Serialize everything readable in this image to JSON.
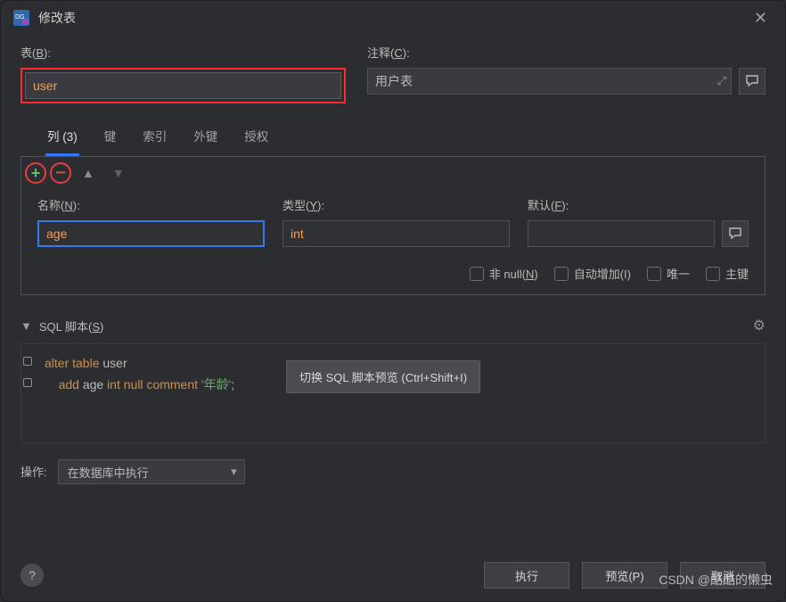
{
  "window": {
    "title": "修改表"
  },
  "labels": {
    "table": "表(",
    "table_u": "B",
    "table_end": "):",
    "comment": "注释(",
    "comment_u": "C",
    "comment_end": "):",
    "name": "名称(",
    "name_u": "N",
    "name_end": "):",
    "type": "类型(",
    "type_u": "Y",
    "type_end": "):",
    "default": "默认(",
    "default_u": "F",
    "default_end": "):",
    "sql": "SQL 脚本(",
    "sql_u": "S",
    "sql_end": ")",
    "ops": "操作:"
  },
  "fields": {
    "table_name": "user",
    "comment": "用户表",
    "col_name": "age",
    "col_type": "int",
    "col_default": ""
  },
  "tabs": [
    "列 (3)",
    "键",
    "索引",
    "外键",
    "授权"
  ],
  "checks": {
    "notnull": "非 null(",
    "notnull_u": "N",
    "notnull_end": ")",
    "autoinc": "自动增加(I)",
    "unique": "唯一",
    "pk": "主键"
  },
  "tooltip": "切换 SQL 脚本预览 (Ctrl+Shift+I)",
  "sql": {
    "l1_kw1": "alter",
    "l1_kw2": "table",
    "l1_id": "user",
    "l2_kw1": "add",
    "l2_id": "age",
    "l2_kw2": "int",
    "l2_kw3": "null",
    "l2_kw4": "comment",
    "l2_str": "'年龄'",
    "l2_end": ";"
  },
  "ops_select": "在数据库中执行",
  "buttons": {
    "exec": "执行",
    "preview": "预览(P)",
    "cancel": "取消"
  },
  "watermark": "CSDN @酷酷的懒虫"
}
